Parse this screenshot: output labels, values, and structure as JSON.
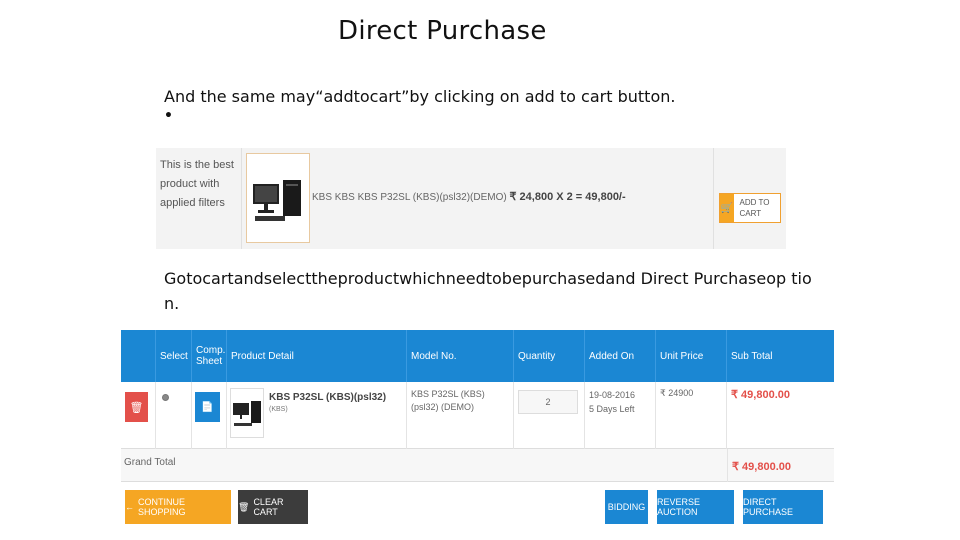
{
  "slide": {
    "title": "Direct Purchase",
    "line1": "And the same may“addtocart”by clicking on add to cart button.",
    "bullet": "•",
    "line2": "Gotocartandselecttheproductwhichneedtobepurchasedand Direct Purchaseop tion."
  },
  "product_strip": {
    "best_text": "This is the best product with applied filters",
    "product_info": "KBS KBS KBS P32SL (KBS)(psl32)(DEMO)",
    "price": "₹ 24,800 X 2 = 49,800/-",
    "add_to_cart": "ADD TO CART"
  },
  "cart": {
    "headers": [
      "Select",
      "Comp. Sheet",
      "Product Detail",
      "Model No.",
      "Quantity",
      "Added On",
      "Unit Price",
      "Sub Total"
    ],
    "row": {
      "product_name": "KBS P32SL (KBS)(psl32)",
      "product_brand": "(KBS)",
      "model_no": "KBS P32SL (KBS)(psl32) (DEMO)",
      "quantity": "2",
      "added_on": "19-08-2016",
      "days_left": "5 Days Left",
      "unit_price": "₹ 24900",
      "sub_total": "₹ 49,800.00"
    },
    "grand_total_label": "Grand Total",
    "grand_total": "₹ 49,800.00"
  },
  "actions": {
    "continue_shopping": "CONTINUE SHOPPING",
    "clear_cart": "CLEAR CART",
    "bidding": "BIDDING",
    "reverse_auction": "REVERSE AUCTION",
    "direct_purchase": "DIRECT PURCHASE"
  },
  "icons": {
    "cart": "cart-icon",
    "trash": "trash-icon",
    "document": "document-icon",
    "arrow_left": "arrow-left-icon"
  },
  "colors": {
    "header_blue": "#1b87d3",
    "accent_orange": "#f5a623",
    "delete_red": "#e3504a",
    "dark_button": "#3c3c3c"
  }
}
